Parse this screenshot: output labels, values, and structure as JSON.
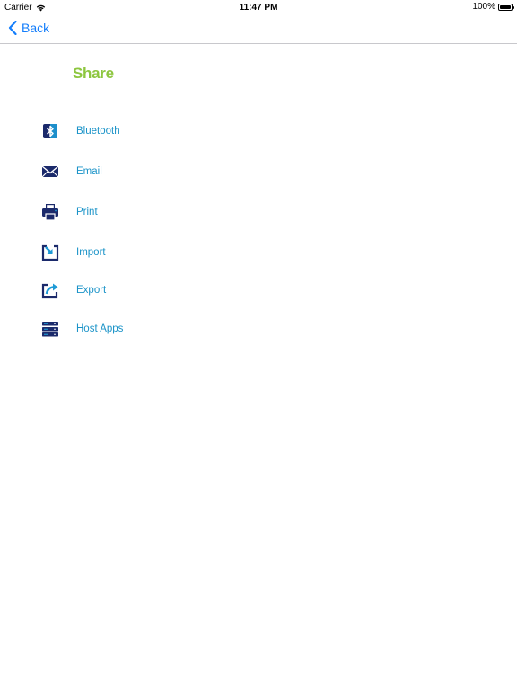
{
  "status_bar": {
    "carrier": "Carrier",
    "time": "11:47 PM",
    "battery": "100%"
  },
  "nav": {
    "back_label": "Back"
  },
  "page": {
    "title": "Share"
  },
  "menu": {
    "items": [
      {
        "label": "Bluetooth",
        "icon": "bluetooth-icon"
      },
      {
        "label": "Email",
        "icon": "envelope-icon"
      },
      {
        "label": "Print",
        "icon": "printer-icon"
      },
      {
        "label": "Import",
        "icon": "import-icon"
      },
      {
        "label": "Export",
        "icon": "export-icon"
      },
      {
        "label": "Host Apps",
        "icon": "server-stack-icon"
      }
    ]
  },
  "colors": {
    "title_green": "#8dc63f",
    "link_blue": "#1a93c8",
    "ios_blue": "#147efb",
    "icon_navy": "#1b2a6b",
    "icon_accent": "#1e9ad6"
  }
}
